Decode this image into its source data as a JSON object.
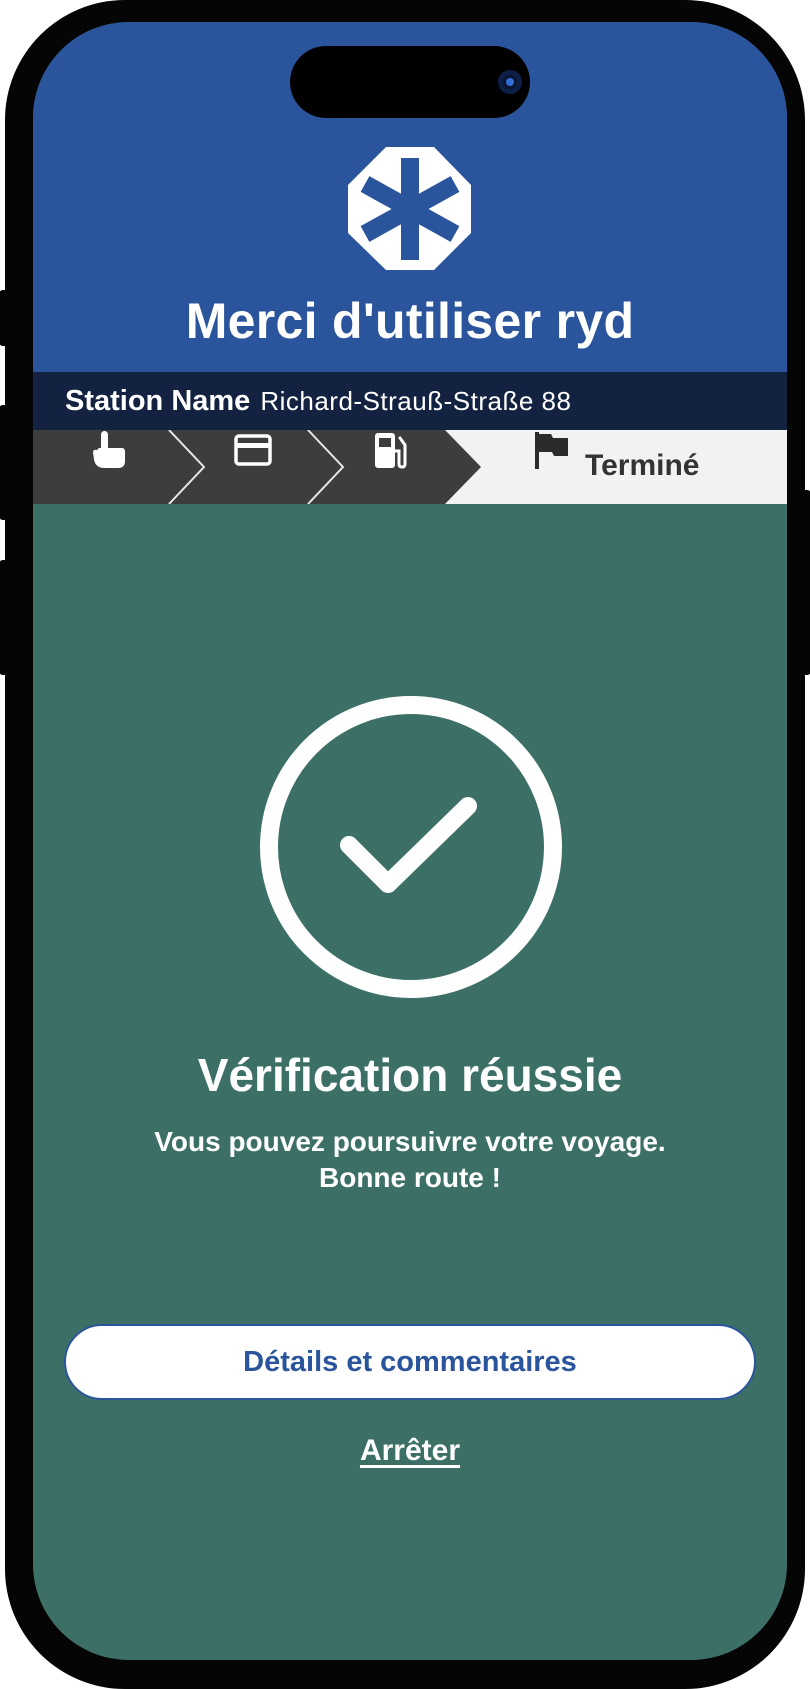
{
  "header": {
    "title": "Merci d'utiliser ryd",
    "logo_icon": "ryd-asterisk-logo",
    "background": "#2a549b"
  },
  "station": {
    "label": "Station Name",
    "value": "Richard-Strauß-Straße 88"
  },
  "steps": {
    "items": [
      {
        "icon": "hand-pointer-icon",
        "state": "completed"
      },
      {
        "icon": "credit-card-icon",
        "state": "completed"
      },
      {
        "icon": "fuel-pump-icon",
        "state": "completed"
      },
      {
        "icon": "flag-icon",
        "state": "active",
        "label": "Terminé"
      }
    ]
  },
  "result": {
    "icon": "check-circle-icon",
    "title": "Vérification réussie",
    "line1": "Vous pouvez poursuivre votre voyage.",
    "line2": "Bonne route !"
  },
  "actions": {
    "details_label": "Détails et commentaires",
    "stop_label": "Arrêter"
  },
  "colors": {
    "brand_blue": "#2a549b",
    "station_bar": "#122240",
    "success_green": "#3c7066",
    "step_dark": "#3d3d3d"
  }
}
